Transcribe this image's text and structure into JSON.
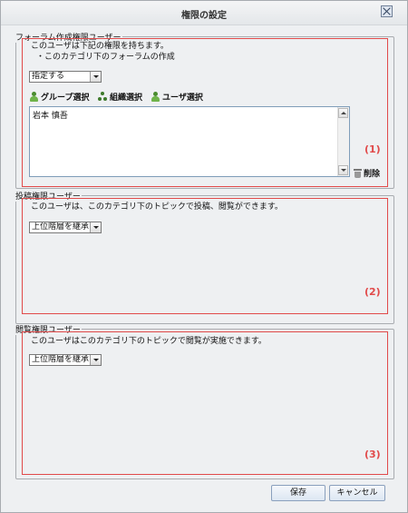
{
  "dialog": {
    "title": "権限の設定"
  },
  "section1": {
    "legend": "フォーラム作成権限ユーザー",
    "line1": "このユーザは下記の権限を持ちます。",
    "line2": "・このカテゴリ下のフォーラムの作成",
    "select_value": "指定する",
    "pickers": {
      "group": "グループ選択",
      "org": "組織選択",
      "user": "ユーザ選択"
    },
    "list_items": [
      "岩本 慎吾"
    ],
    "delete_label": "削除",
    "marker": "(1)"
  },
  "section2": {
    "legend": "投稿権限ユーザー",
    "description": "このユーザは、このカテゴリ下のトピックで投稿、閲覧ができます。",
    "select_value": "上位階層を継承",
    "marker": "(2)"
  },
  "section3": {
    "legend": "閲覧権限ユーザー",
    "description": "このユーザはこのカテゴリ下のトピックで閲覧が実施できます。",
    "select_value": "上位階層を継承",
    "marker": "(3)"
  },
  "footer": {
    "save_label": "保存",
    "cancel_label": "キャンセル"
  },
  "colors": {
    "marker_red": "#e14a4a",
    "dialog_bg": "#eef0f2"
  }
}
